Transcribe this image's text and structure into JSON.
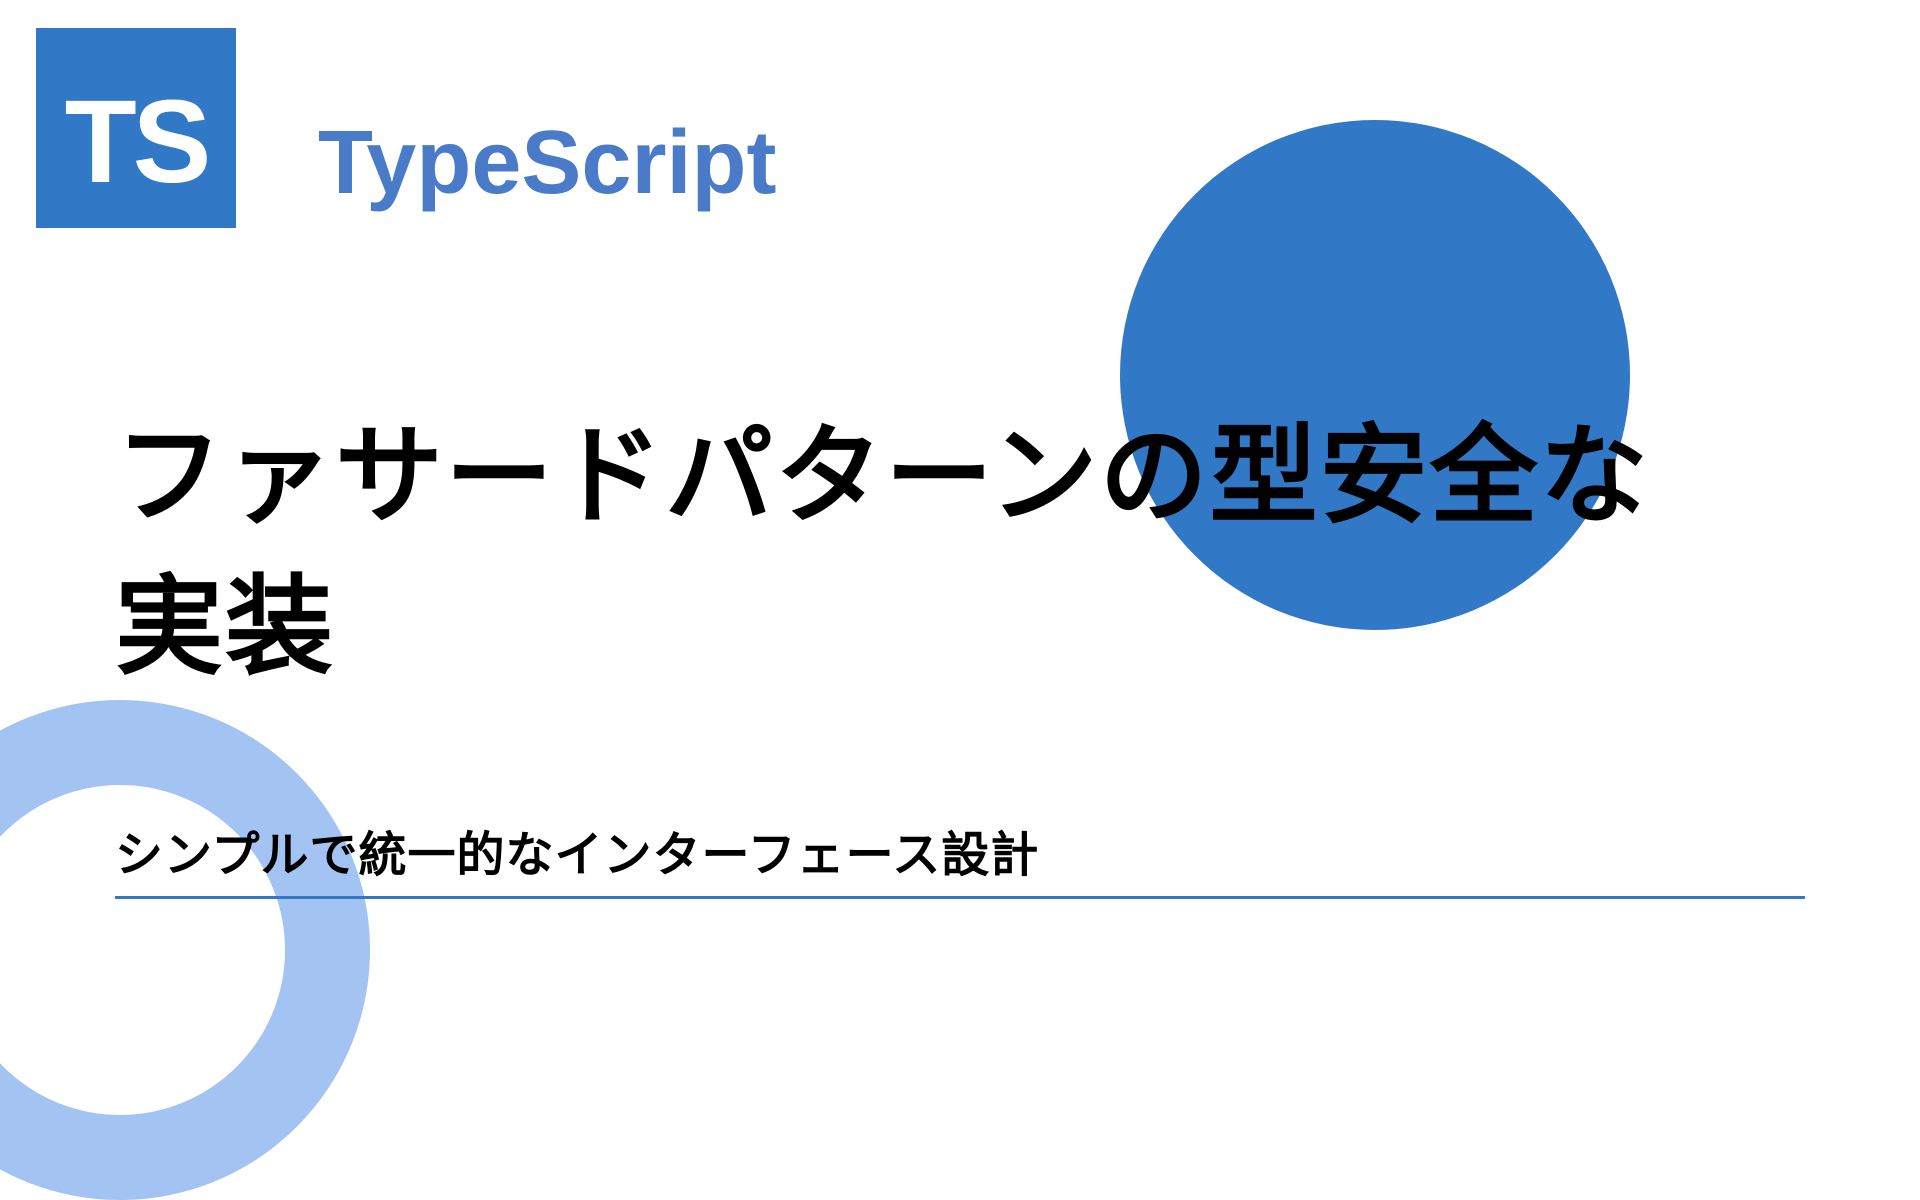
{
  "logo": {
    "text": "TS"
  },
  "brand": "TypeScript",
  "title": "ファサードパターンの型安全な実装",
  "subtitle": "シンプルで統一的なインターフェース設計",
  "colors": {
    "primary": "#3178c6",
    "accent": "#a3c4f3"
  }
}
